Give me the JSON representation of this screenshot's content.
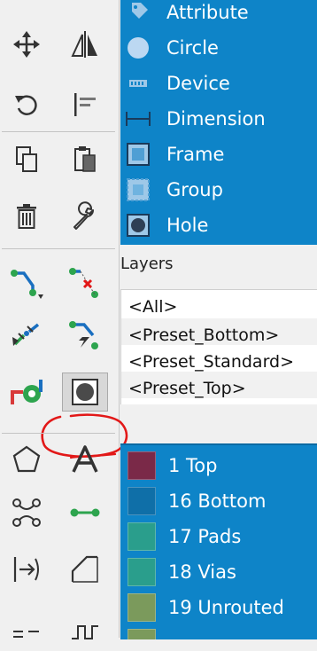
{
  "object_types": [
    {
      "icon": "attribute-icon",
      "label": "Attribute"
    },
    {
      "icon": "circle-icon",
      "label": "Circle"
    },
    {
      "icon": "device-icon",
      "label": "Device"
    },
    {
      "icon": "dimension-icon",
      "label": "Dimension"
    },
    {
      "icon": "frame-icon",
      "label": "Frame"
    },
    {
      "icon": "group-icon",
      "label": "Group"
    },
    {
      "icon": "hole-icon",
      "label": "Hole"
    }
  ],
  "layers_panel": {
    "title": "Layers",
    "presets": [
      "<All>",
      "<Preset_Bottom>",
      "<Preset_Standard>",
      "<Preset_Top>"
    ]
  },
  "layer_list": [
    {
      "label": "1 Top",
      "color": "#7a2948"
    },
    {
      "label": "16 Bottom",
      "color": "#0f6fa8"
    },
    {
      "label": "17 Pads",
      "color": "#2a9e8c"
    },
    {
      "label": "18 Vias",
      "color": "#2a9e8c"
    },
    {
      "label": "19 Unrouted",
      "color": "#7b9a5c"
    }
  ],
  "toolbar_tools": [
    "move-icon",
    "mirror-icon",
    "rotate-icon",
    "align-icon",
    "copy-icon",
    "paste-icon",
    "delete-icon",
    "wrench-icon",
    "route-icon",
    "ripup-icon",
    "split-icon",
    "optimize-icon",
    "via-icon",
    "hole-icon",
    "polygon-icon",
    "text-icon",
    "airwire-icon",
    "wire-icon",
    "miter-icon",
    "arc-icon"
  ],
  "colors": {
    "panel_blue": "#0e84c8",
    "annotation_red": "#e21818",
    "toolbar_bg": "#f0f0f0"
  }
}
